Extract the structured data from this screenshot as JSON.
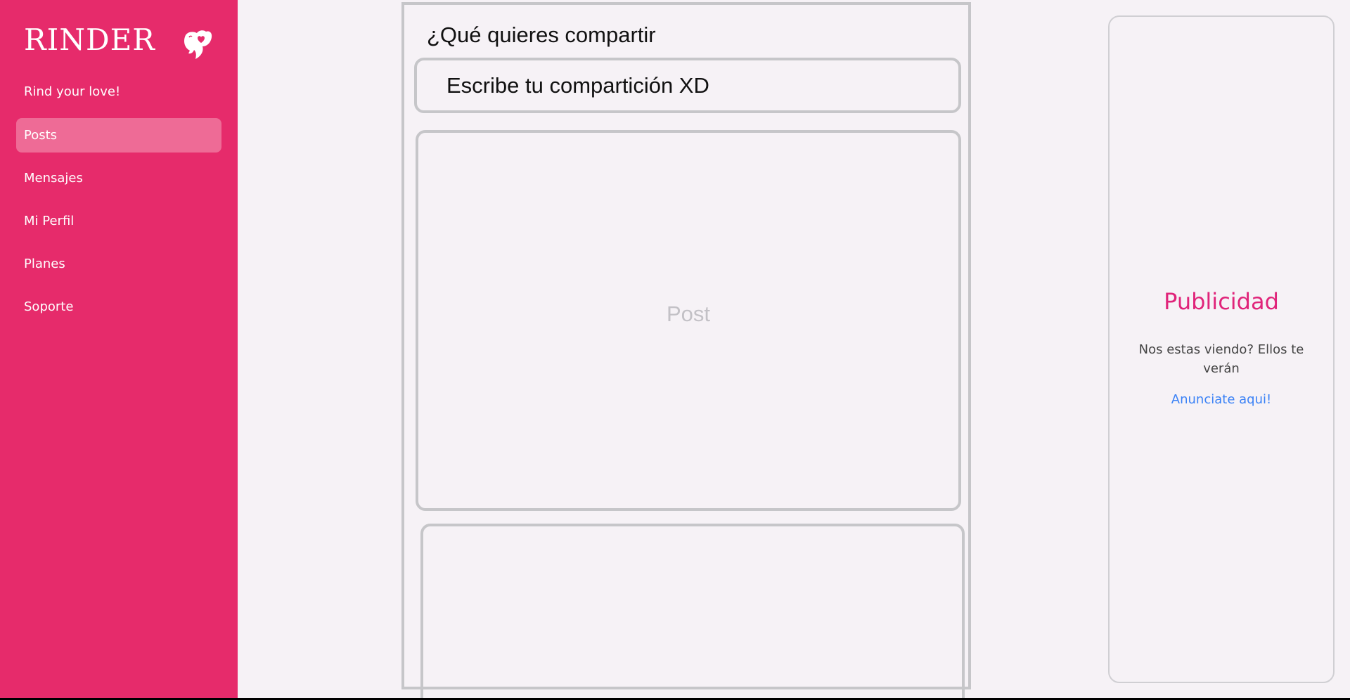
{
  "sidebar": {
    "brand": "RINDER",
    "logo_icon": "heart-logo-icon",
    "tagline": "Rind your love!",
    "background_color": "#e62b6b",
    "active_item_color": "#ee6b96",
    "items": [
      {
        "label": "Posts",
        "active": true
      },
      {
        "label": "Mensajes",
        "active": false
      },
      {
        "label": "Mi Perfil",
        "active": false
      },
      {
        "label": "Planes",
        "active": false
      },
      {
        "label": "Soporte",
        "active": false
      }
    ]
  },
  "feed": {
    "title": "¿Qué quieres compartir",
    "share_input_value": "Escribe tu compartición XD",
    "post_label": "Post"
  },
  "ad": {
    "title": "Publicidad",
    "text": "Nos estas viendo? Ellos te verán",
    "link": "Anunciate aqui!",
    "title_color": "#e0247a",
    "link_color": "#3b82f6"
  }
}
